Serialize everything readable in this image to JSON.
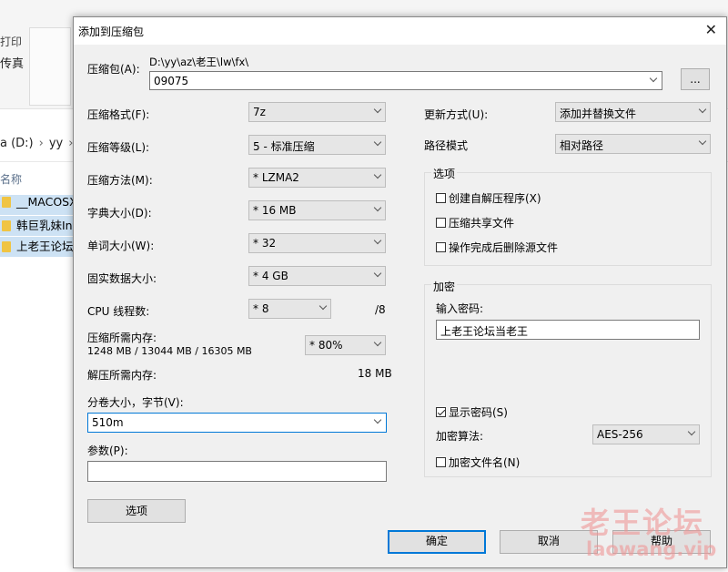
{
  "explorer": {
    "ribbon_line1": "打印",
    "ribbon_line2": "传真",
    "address_drive": "a (D:)",
    "address_folder": "yy",
    "column_name": "名称",
    "items": [
      "__MACOSX",
      "韩巨乳妹Int",
      "上老王论坛"
    ]
  },
  "dialog": {
    "title": "添加到压缩包",
    "archive_label": "压缩包(A):",
    "archive_path": "D:\\yy\\az\\老王\\lw\\fx\\",
    "archive_name": "09075",
    "browse_label": "...",
    "format_label": "压缩格式(F):",
    "format_value": "7z",
    "level_label": "压缩等级(L):",
    "level_value": "5 - 标准压缩",
    "method_label": "压缩方法(M):",
    "method_value": "* LZMA2",
    "dict_label": "字典大小(D):",
    "dict_value": "* 16 MB",
    "word_label": "单词大小(W):",
    "word_value": "* 32",
    "solid_label": "固实数据大小:",
    "solid_value": "* 4 GB",
    "threads_label": "CPU 线程数:",
    "threads_value": "* 8",
    "threads_max": "/8",
    "mem_comp_label": "压缩所需内存:",
    "mem_comp_value": "1248 MB / 13044 MB / 16305 MB",
    "mem_percent": "* 80%",
    "mem_decomp_label": "解压所需内存:",
    "mem_decomp_value": "18 MB",
    "split_label": "分卷大小，字节(V):",
    "split_value": "510m",
    "params_label": "参数(P):",
    "params_value": "",
    "options_button": "选项",
    "update_label": "更新方式(U):",
    "update_value": "添加并替换文件",
    "path_label": "路径模式",
    "path_value": "相对路径",
    "options_group": "选项",
    "opt_sfx": "创建自解压程序(X)",
    "opt_shared": "压缩共享文件",
    "opt_delete": "操作完成后删除源文件",
    "encrypt_group": "加密",
    "password_label": "输入密码:",
    "password_value": "上老王论坛当老王",
    "show_password": "显示密码(S)",
    "enc_method_label": "加密算法:",
    "enc_method_value": "AES-256",
    "encrypt_names": "加密文件名(N)",
    "ok": "确定",
    "cancel": "取消",
    "help": "帮助"
  },
  "watermark": {
    "line1": "老王论坛",
    "line2": "laowang.vip"
  }
}
